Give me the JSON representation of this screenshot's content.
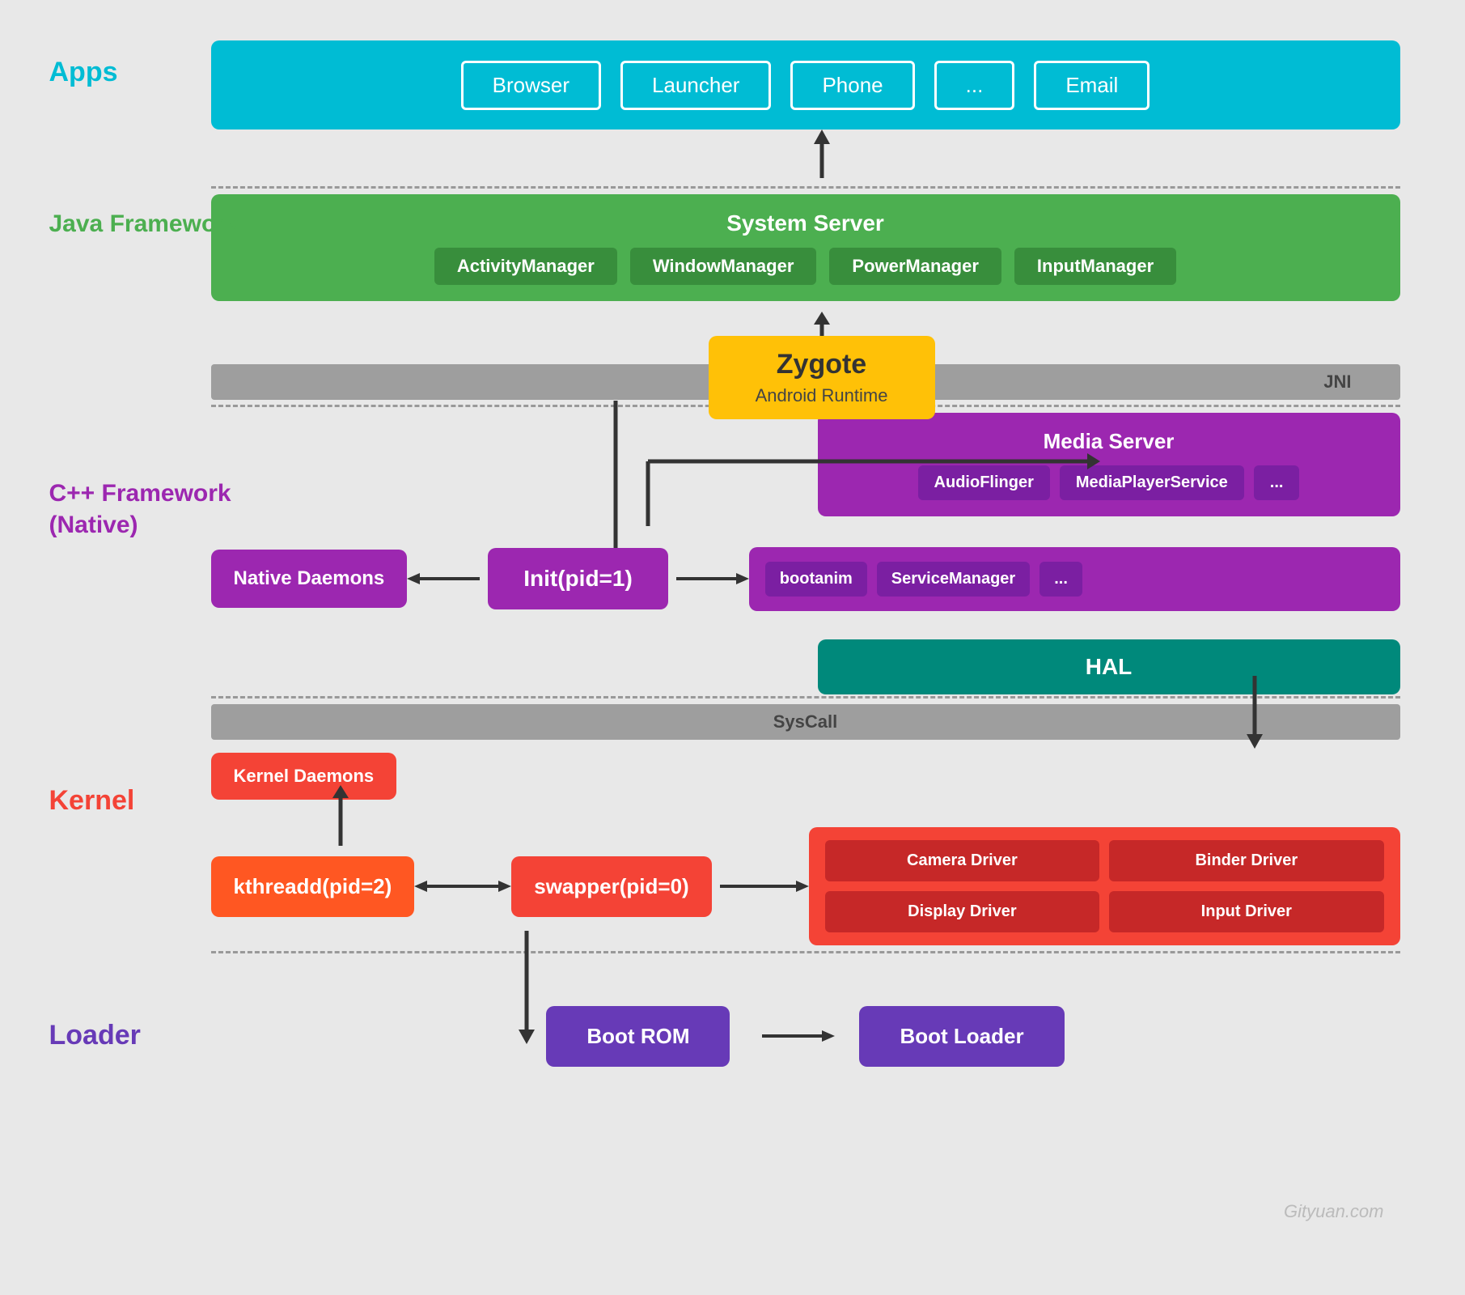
{
  "colors": {
    "apps": "#00bcd4",
    "java_framework": "#4caf50",
    "cpp_framework": "#9c27b0",
    "kernel": "#f44336",
    "loader": "#673ab7",
    "hal": "#00897b",
    "zygote": "#ffc107",
    "gray": "#9e9e9e",
    "bg": "#e8e8e8"
  },
  "apps": {
    "label": "Apps",
    "items": [
      "Browser",
      "Launcher",
      "Phone",
      "...",
      "Email"
    ]
  },
  "java_framework": {
    "label": "Java Framework",
    "system_server": {
      "title": "System Server",
      "items": [
        "ActivityManager",
        "WindowManager",
        "PowerManager",
        "InputManager"
      ]
    },
    "jni_label": "JNI"
  },
  "zygote": {
    "title": "Zygote",
    "sub": "Android Runtime"
  },
  "cpp_framework": {
    "label": "C++ Framework\n(Native)",
    "label_line1": "C++ Framework",
    "label_line2": "(Native)",
    "media_server": {
      "title": "Media Server",
      "items": [
        "AudioFlinger",
        "MediaPlayerService",
        "..."
      ]
    },
    "init": {
      "label": "Init(pid=1)",
      "left": "Native Daemons",
      "right_items": [
        "bootanim",
        "ServiceManager",
        "..."
      ]
    },
    "hal": "HAL"
  },
  "syscall": "SysCall",
  "kernel": {
    "label": "Kernel",
    "daemons": "Kernel Daemons",
    "kthreadd": "kthreadd(pid=2)",
    "swapper": "swapper(pid=0)",
    "drivers": [
      "Camera Driver",
      "Binder Driver",
      "Display Driver",
      "Input Driver"
    ]
  },
  "loader": {
    "label": "Loader",
    "boot_rom": "Boot ROM",
    "boot_loader": "Boot Loader"
  },
  "watermark": "Gityuan.com"
}
